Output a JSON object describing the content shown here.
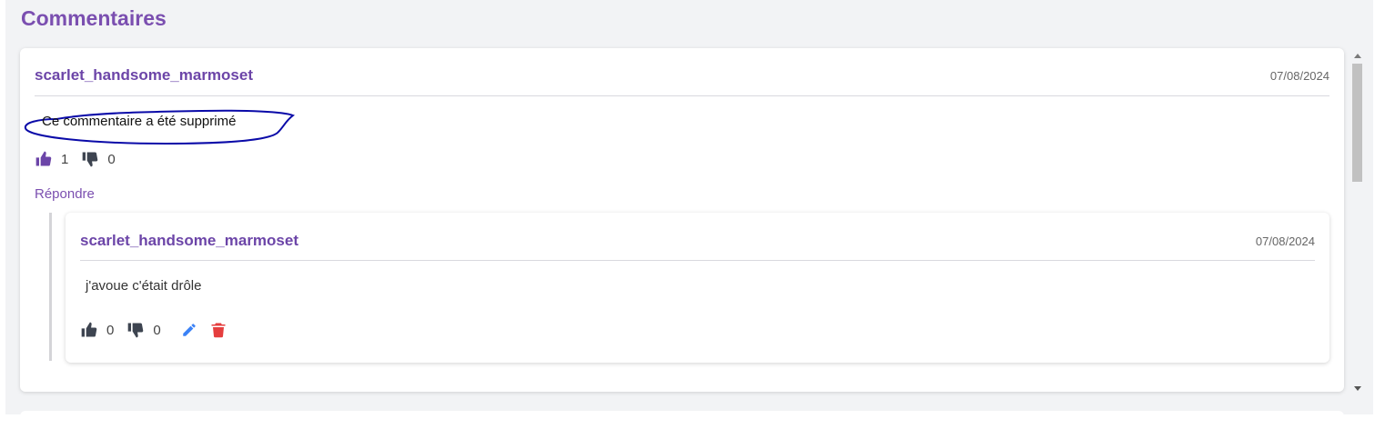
{
  "section": {
    "title": "Commentaires"
  },
  "comment": {
    "author": "scarlet_handsome_marmoset",
    "date": "07/08/2024",
    "text": "Ce commentaire a été supprimé",
    "likes": "1",
    "dislikes": "0",
    "reply_label": "Répondre",
    "icons": {
      "like": "thumbs-up-icon",
      "dislike": "thumbs-down-icon"
    }
  },
  "reply": {
    "author": "scarlet_handsome_marmoset",
    "date": "07/08/2024",
    "text": "j'avoue c'était drôle",
    "likes": "0",
    "dislikes": "0",
    "icons": {
      "like": "thumbs-up-icon",
      "dislike": "thumbs-down-icon",
      "edit": "pencil-icon",
      "delete": "trash-icon"
    }
  },
  "colors": {
    "accent": "#7b4fb0",
    "like_active": "#6c45a8",
    "icon_default": "#3d4450",
    "edit": "#3b82f6",
    "delete": "#e53e3e",
    "annotation": "#0a0aa8"
  }
}
